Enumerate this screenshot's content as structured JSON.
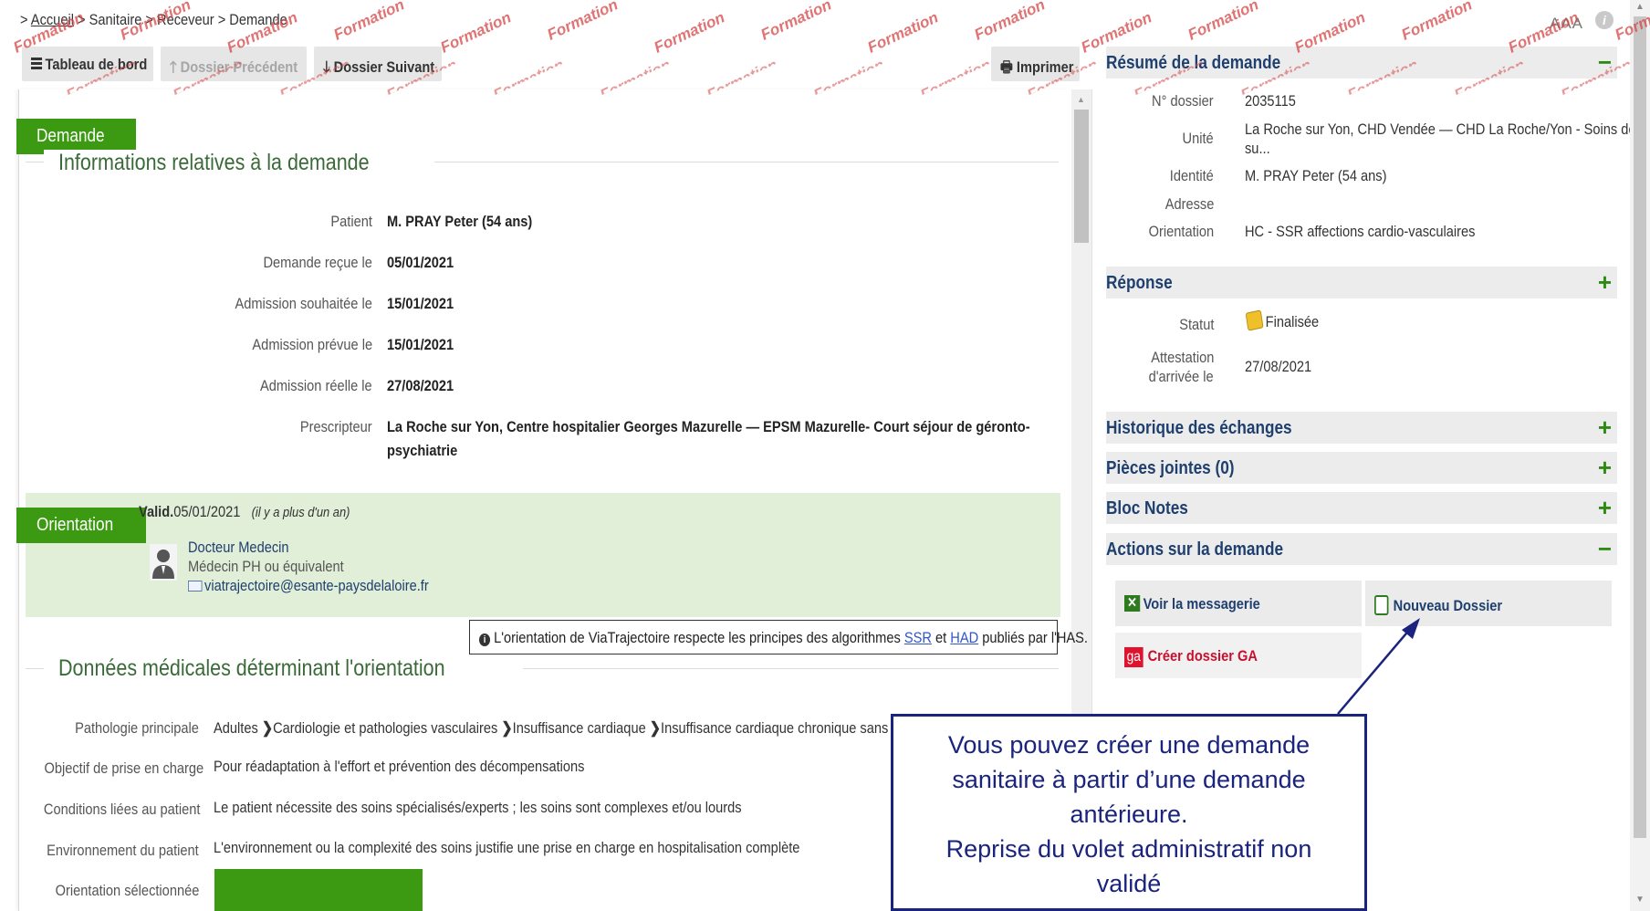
{
  "watermark": "Formation",
  "breadcrumb": {
    "prefix": ">",
    "home": "Accueil",
    "sep": ">",
    "items": [
      "Sanitaire",
      "Receveur",
      "Demande"
    ]
  },
  "accessibility": {
    "font_size_label": "AAA",
    "info": "i"
  },
  "toolbar": {
    "dashboard": "Tableau de bord",
    "previous": "Dossier Précédent",
    "next": "Dossier Suivant",
    "print": "Imprimer"
  },
  "demande": {
    "badge": "Demande",
    "title": "Informations relatives à la demande",
    "fields": [
      {
        "label": "Patient",
        "value": "M. PRAY Peter (54 ans)"
      },
      {
        "label": "Demande reçue le",
        "value": "05/01/2021"
      },
      {
        "label": "Admission souhaitée le",
        "value": "15/01/2021"
      },
      {
        "label": "Admission prévue le",
        "value": "15/01/2021"
      },
      {
        "label": "Admission réelle le",
        "value": "27/08/2021"
      },
      {
        "label": "Prescripteur",
        "value": "La Roche sur Yon, Centre hospitalier Georges Mazurelle — EPSM Mazurelle- Court séjour de géronto-",
        "value_line2": "psychiatrie"
      }
    ]
  },
  "orientation": {
    "badge": "Orientation",
    "valid_label": "Valid.",
    "valid_date": "05/01/2021",
    "ago": "(il y a plus d'un an)",
    "doctor_name": "Docteur Medecin",
    "doctor_role": "Médecin PH ou équivalent",
    "doctor_email": "viatrajectoire@esante-paysdelaloire.fr",
    "note_prefix": "L'orientation de ViaTrajectoire respecte les principes des algorithmes",
    "note_ssr": "SSR",
    "note_and": "et",
    "note_had": "HAD",
    "note_suffix": "publiés par l'HAS."
  },
  "medical": {
    "title": "Données médicales déterminant l'orientation",
    "pathologie_label": "Pathologie principale",
    "pathologie_path": [
      "Adultes",
      "Cardiologie et pathologies vasculaires",
      "Insuffisance cardiaque",
      "Insuffisance cardiaque chronique sans décom"
    ],
    "rows": [
      {
        "label": "Objectif de prise en charge",
        "value": "Pour réadaptation à l'effort et prévention des décompensations"
      },
      {
        "label": "Conditions liées au patient",
        "value": "Le patient nécessite des soins spécialisés/experts ; les soins sont complexes et/ou lourds"
      },
      {
        "label": "Environnement du patient",
        "value": "L'environnement ou la complexité des soins justifie une prise en charge en hospitalisation complète"
      }
    ],
    "selected_label": "Orientation sélectionnée",
    "selected_color": "#3b9a12"
  },
  "summary": {
    "title": "Résumé de la demande",
    "toggle": "−",
    "rows": [
      {
        "label": "N° dossier",
        "value": "2035115"
      },
      {
        "label": "Unité",
        "value": "La Roche sur Yon, CHD Vendée — CHD La Roche/Yon - Soins de",
        "value_line2": "su..."
      },
      {
        "label": "Identité",
        "value": "M. PRAY Peter (54 ans)"
      },
      {
        "label": "Adresse",
        "value": ""
      },
      {
        "label": "Orientation",
        "value": "HC - SSR affections cardio-vasculaires"
      }
    ]
  },
  "reponse": {
    "title": "Réponse",
    "toggle": "+",
    "statut_label": "Statut",
    "statut_value": "Finalisée",
    "attestation_label_1": "Attestation",
    "attestation_label_2": "d'arrivée le",
    "attestation_value": "27/08/2021"
  },
  "panels": [
    {
      "title": "Historique des échanges",
      "toggle": "+"
    },
    {
      "title": "Pièces jointes (0)",
      "toggle": "+"
    },
    {
      "title": "Bloc Notes",
      "toggle": "+"
    }
  ],
  "actions": {
    "title": "Actions sur la demande",
    "toggle": "−",
    "messagerie": "Voir la messagerie",
    "nouveau": "Nouveau Dossier",
    "ga_icon": "ga",
    "creer_ga": "Créer dossier GA"
  },
  "callout": {
    "line1": "Vous pouvez créer une demande",
    "line2": "sanitaire à partir d’une demande",
    "line3": "antérieure.",
    "line4": "Reprise du volet administratif non",
    "line5": "validé"
  },
  "colors": {
    "accent_green": "#3b9a12",
    "link_blue": "#1f3f6e",
    "callout_navy": "#1a237e",
    "watermark_red": "#d64545"
  }
}
